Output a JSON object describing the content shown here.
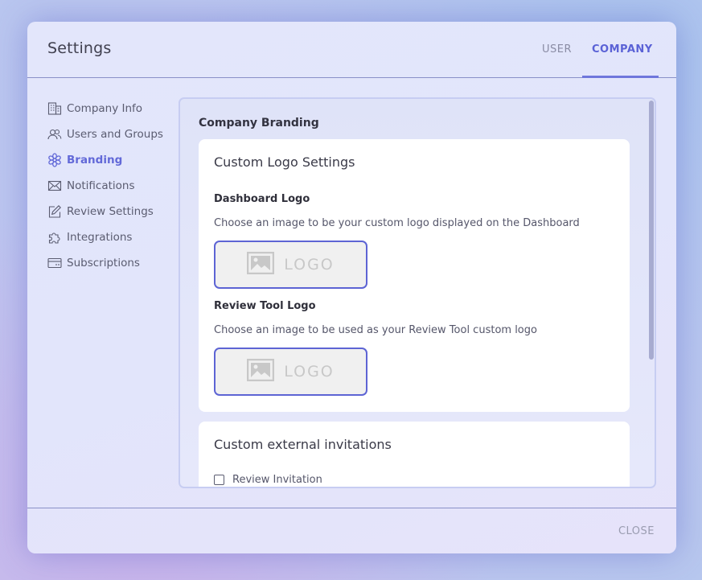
{
  "dialog": {
    "title": "Settings",
    "tabs": [
      {
        "label": "USER",
        "active": false
      },
      {
        "label": "COMPANY",
        "active": true
      }
    ]
  },
  "sidebar": {
    "items": [
      {
        "label": "Company Info",
        "icon": "building-icon",
        "active": false
      },
      {
        "label": "Users and Groups",
        "icon": "users-icon",
        "active": false
      },
      {
        "label": "Branding",
        "icon": "flower-icon",
        "active": true
      },
      {
        "label": "Notifications",
        "icon": "envelope-icon",
        "active": false
      },
      {
        "label": "Review Settings",
        "icon": "edit-icon",
        "active": false
      },
      {
        "label": "Integrations",
        "icon": "puzzle-icon",
        "active": false
      },
      {
        "label": "Subscriptions",
        "icon": "card-icon",
        "active": false
      }
    ]
  },
  "main": {
    "section_title": "Company Branding",
    "logo_card": {
      "title": "Custom Logo Settings",
      "dashboard_logo": {
        "label": "Dashboard Logo",
        "description": "Choose an image to be your custom logo displayed on the Dashboard",
        "placeholder_text": "LOGO"
      },
      "review_tool_logo": {
        "label": "Review Tool Logo",
        "description": "Choose an image to be used as your Review Tool custom logo",
        "placeholder_text": "LOGO"
      }
    },
    "invitations_card": {
      "title": "Custom external invitations",
      "checkbox_label": "Review Invitation",
      "checked": false
    }
  },
  "footer": {
    "close_label": "CLOSE"
  },
  "colors": {
    "accent": "#5d64d4",
    "text": "#3a3a48"
  }
}
